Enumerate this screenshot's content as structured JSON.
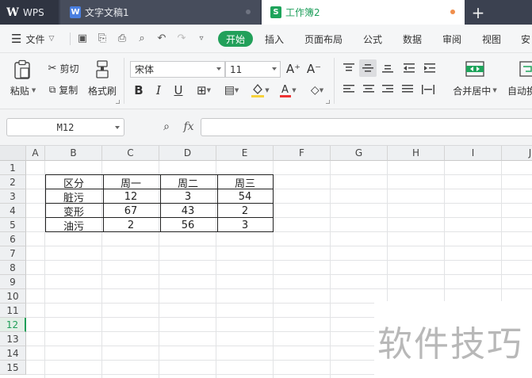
{
  "tabs": {
    "wps": "WPS",
    "doc": "文字文稿1",
    "book": "工作簿2",
    "new": "+"
  },
  "menu": {
    "file": "文件",
    "start": "开始",
    "items": [
      "插入",
      "页面布局",
      "公式",
      "数据",
      "审阅",
      "视图",
      "安"
    ]
  },
  "ribbon": {
    "paste": "粘贴",
    "cut": "剪切",
    "copy": "复制",
    "format_painter": "格式刷",
    "font_name": "宋体",
    "font_size": "11",
    "merge_center": "合并居中",
    "auto_wrap": "自动换"
  },
  "formula_bar": {
    "name_box": "M12",
    "fx": "fx",
    "formula": ""
  },
  "columns": [
    "A",
    "B",
    "C",
    "D",
    "E",
    "F",
    "G",
    "H",
    "I",
    "J"
  ],
  "rows": [
    "1",
    "2",
    "3",
    "4",
    "5",
    "6",
    "7",
    "8",
    "9",
    "10",
    "11",
    "12",
    "13",
    "14",
    "15"
  ],
  "active_row": "12",
  "table": {
    "header": [
      "区分",
      "周一",
      "周二",
      "周三"
    ],
    "rows": [
      [
        "脏污",
        "12",
        "3",
        "54"
      ],
      [
        "变形",
        "67",
        "43",
        "2"
      ],
      [
        "油污",
        "2",
        "56",
        "3"
      ]
    ]
  },
  "watermark": "软件技巧",
  "colors": {
    "accent": "#22a05a",
    "tabbar": "#3b4150"
  }
}
